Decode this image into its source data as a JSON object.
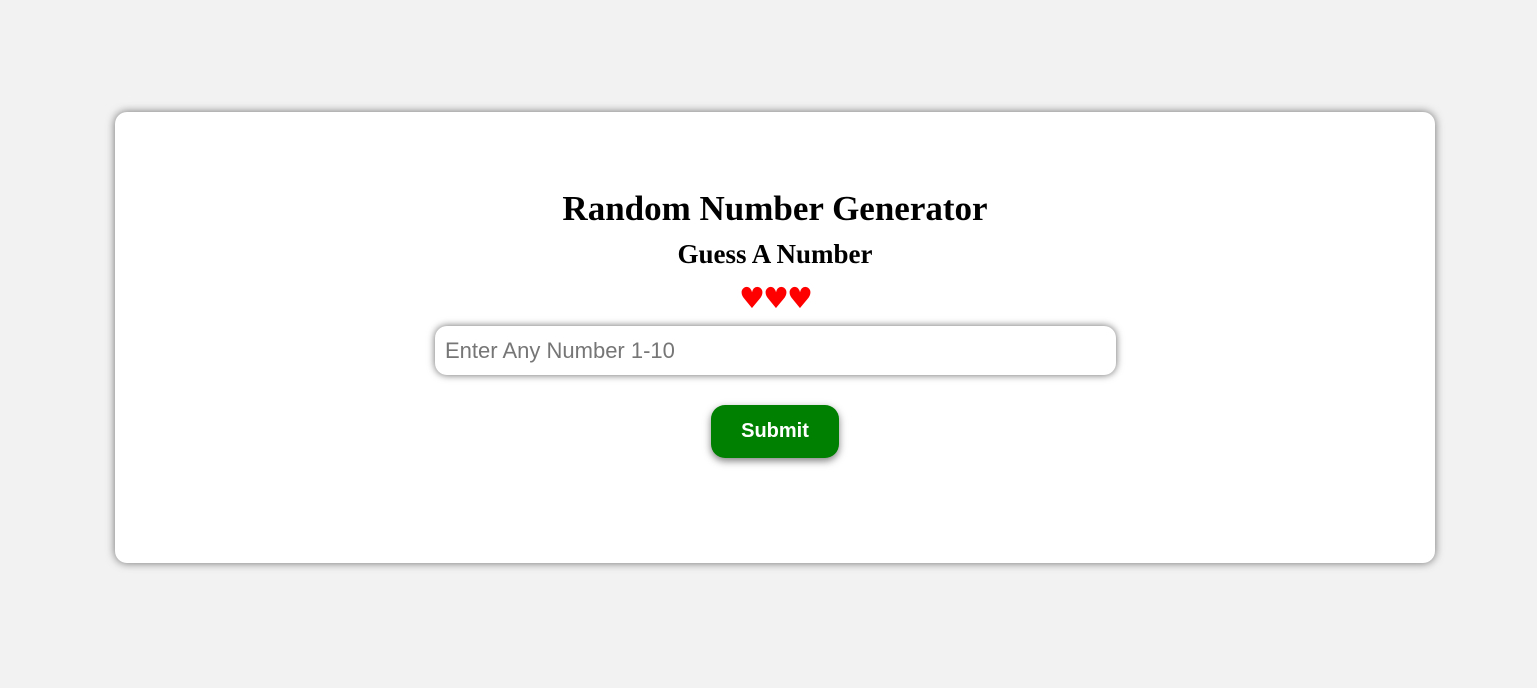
{
  "app": {
    "title": "Random Number Generator",
    "subtitle": "Guess A Number",
    "lives": {
      "symbols": "♥♥♥",
      "count": 3,
      "color": "#ff0000"
    }
  },
  "form": {
    "input_placeholder": "Enter Any Number 1-10",
    "input_value": "",
    "submit_label": "Submit",
    "submit_color": "#008000"
  }
}
